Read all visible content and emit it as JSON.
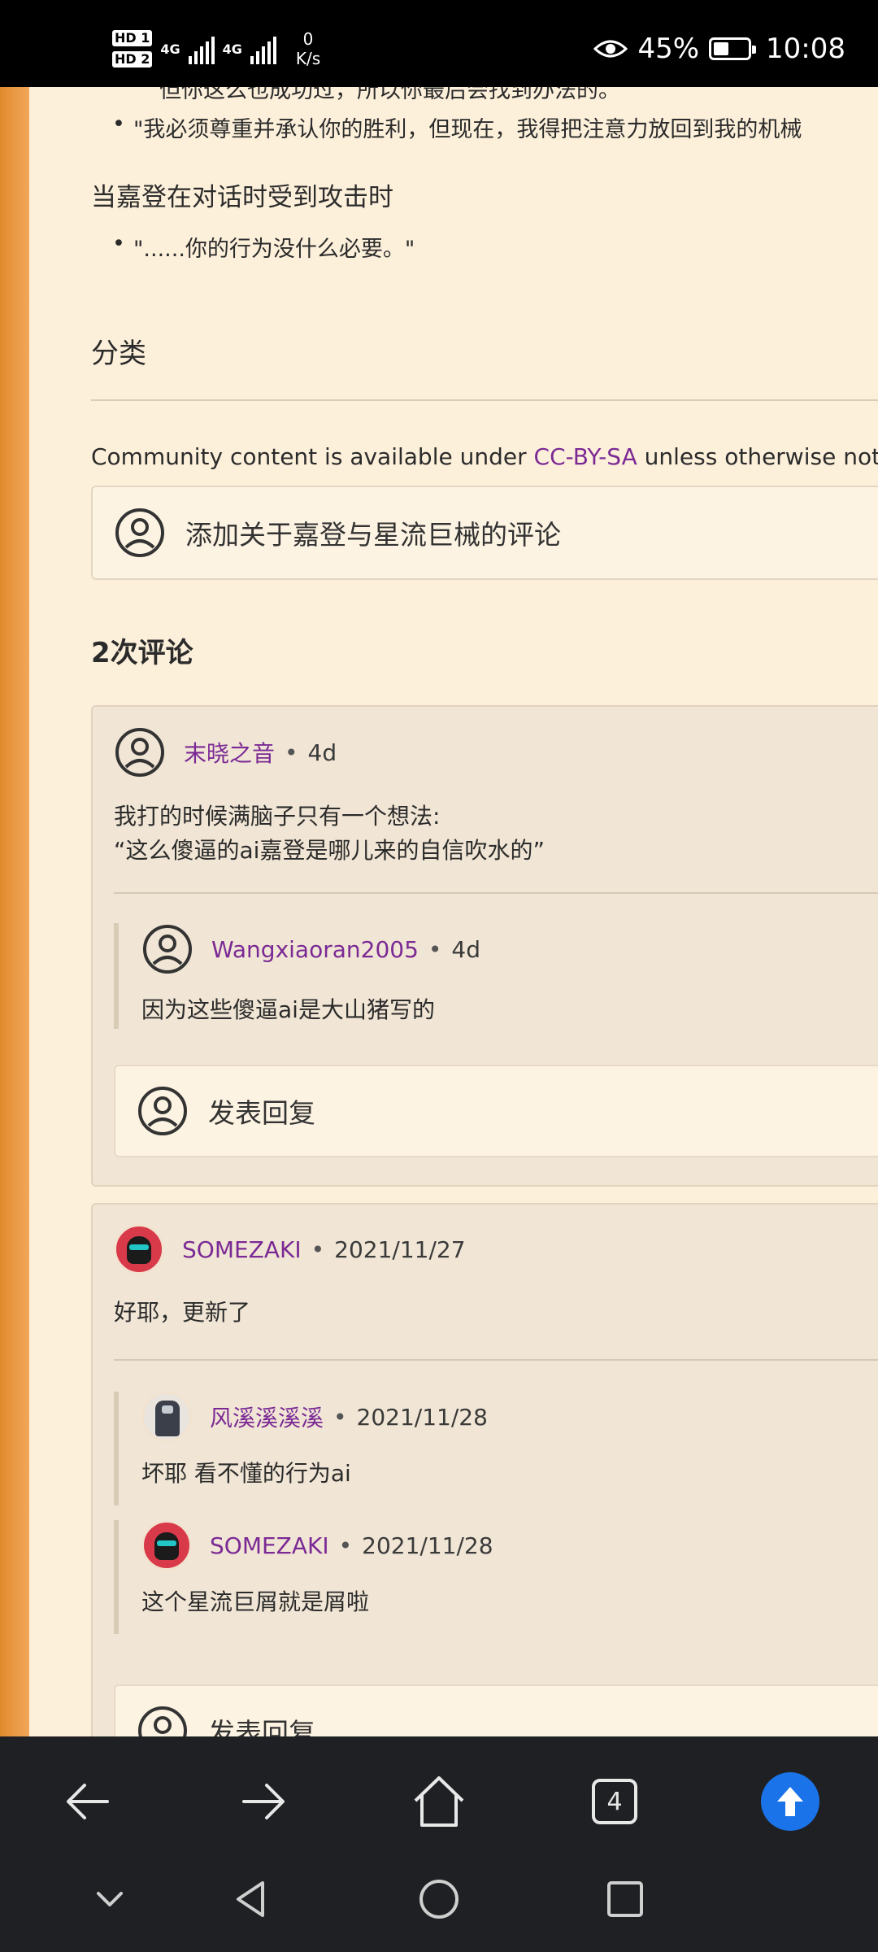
{
  "status_bar": {
    "hd1": "HD 1",
    "hd2": "HD 2",
    "net1": "4G",
    "net2": "4G",
    "speed_value": "0",
    "speed_unit": "K/s",
    "battery_percent": "45%",
    "time": "10:08",
    "battery_level": 0.45
  },
  "article": {
    "cut_line": "但你这么也成功过，所以你最后会找到办法的。",
    "quote1": "\"我必须尊重并承认你的胜利，但现在，我得把注意力放回到我的机械",
    "heading_attacked": "当嘉登在对话时受到攻击时",
    "quote2": "\"......你的行为没什么必要。\"",
    "categories_title": "分类",
    "license_prefix": "Community content is available under ",
    "license_link": "CC-BY-SA",
    "license_suffix": " unless otherwise noted."
  },
  "comments": {
    "add_prompt": "添加关于嘉登与星流巨械的评论",
    "count_label": "2次评论",
    "threads": [
      {
        "author": "末晓之音",
        "time": "4d",
        "lines": [
          "我打的时候满脑子只有一个想法:",
          "“这么傻逼的ai嘉登是哪儿来的自信吹水的”"
        ],
        "replies": [
          {
            "author": "Wangxiaoran2005",
            "time": "4d",
            "text": "因为这些傻逼ai是大山猪写的"
          }
        ],
        "reply_prompt": "发表回复"
      },
      {
        "author": "SOMEZAKI",
        "time": "2021/11/27",
        "lines": [
          "好耶，更新了"
        ],
        "replies": [
          {
            "author": "风溪溪溪溪",
            "time": "2021/11/28",
            "text": "坏耶 看不懂的行为ai"
          },
          {
            "author": "SOMEZAKI",
            "time": "2021/11/28",
            "text": "这个星流巨屑就是屑啦"
          }
        ],
        "reply_prompt": "发表回复"
      }
    ],
    "separator": "•"
  },
  "browser_nav": {
    "tab_count": "4",
    "accent": "#1a73e8"
  },
  "icons": {
    "back": "back-arrow-icon",
    "forward": "forward-arrow-icon",
    "home": "home-icon",
    "tabs": "tabs-icon",
    "scroll_top": "scroll-to-top-icon"
  }
}
